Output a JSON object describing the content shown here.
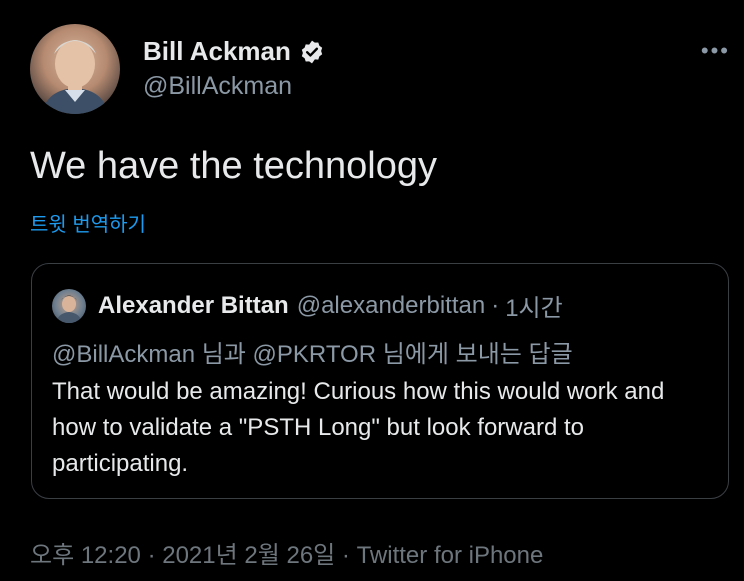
{
  "author": {
    "display_name": "Bill Ackman",
    "handle": "@BillAckman",
    "avatar_icon": "profile-photo",
    "verified_icon": "verified-badge-icon"
  },
  "more_label": "•••",
  "tweet": {
    "text": "We have the technology",
    "translate_label": "트윗 번역하기"
  },
  "quote": {
    "display_name": "Alexander Bittan",
    "handle": "@alexanderbittan",
    "separator": "·",
    "time": "1시간",
    "reply_line": "@BillAckman 님과 @PKRTOR 님에게 보내는 답글",
    "text": "That would be amazing! Curious how this would work and how to validate a \"PSTH Long\" but look forward to participating."
  },
  "footer": {
    "time": "오후 12:20",
    "sep1": "·",
    "date": "2021년 2월 26일",
    "sep2": "·",
    "source": "Twitter for iPhone"
  },
  "colors": {
    "background": "#000000",
    "primary_text": "#e7e9ea",
    "secondary_text": "#8b98a5",
    "link": "#1d9bf0",
    "border": "#3a3f44"
  }
}
